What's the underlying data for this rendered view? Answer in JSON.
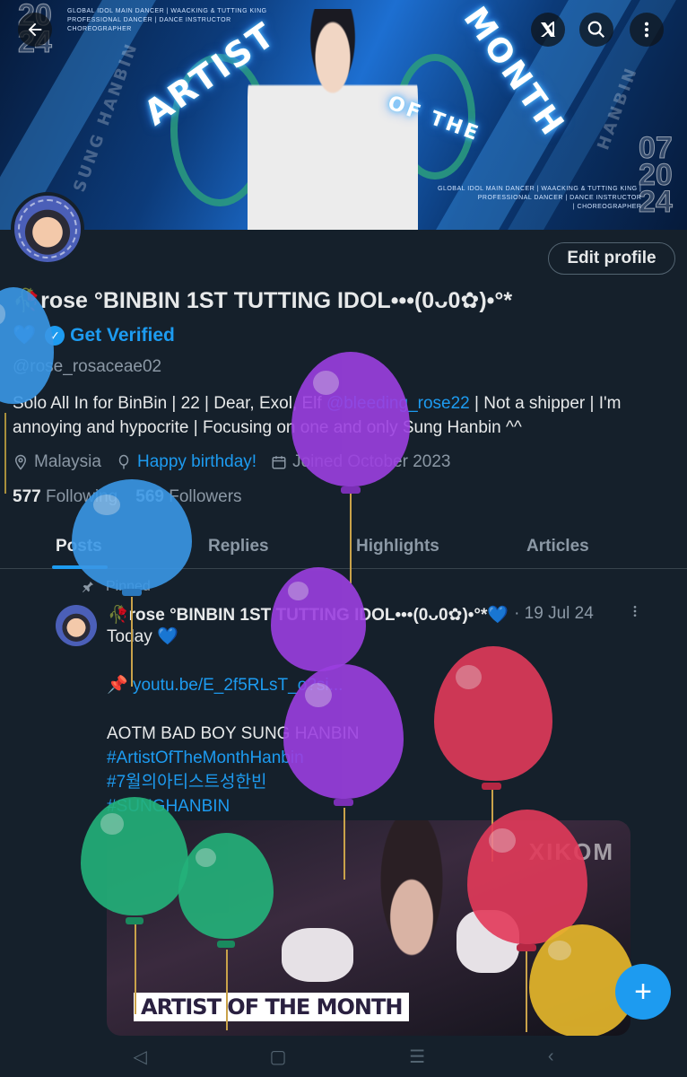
{
  "banner": {
    "headline_left": "ARTIST",
    "headline_of_the": "OF THE",
    "headline_right": "MONTH",
    "year_left": "20\n24",
    "year_right": "07\n20\n24",
    "side_name_left": "SUNG HANBIN",
    "side_name_right": "HANBIN",
    "tagline_left": "GLOBAL IDOL MAIN DANCER | WAACKING & TUTTING KING\nPROFESSIONAL DANCER | DANCE INSTRUCTOR\nCHOREOGRAPHER",
    "tagline_right": "GLOBAL IDOL MAIN DANCER | WAACKING & TUTTING KING |\nPROFESSIONAL DANCER | DANCE INSTRUCTOR\n| CHOREOGRAPHER"
  },
  "top_bar": {
    "back_icon": "arrow-left-icon",
    "grok_icon": "grok-icon",
    "search_icon": "search-icon",
    "more_icon": "more-vertical-icon"
  },
  "profile": {
    "edit_label": "Edit profile",
    "name": "🥀rose °BINBIN 1ST TUTTING IDOL•••(0ᴗ0✿)•°*",
    "name_suffix": "💙",
    "get_verified": "Get Verified",
    "handle": "@rose_rosaceae02",
    "bio_1": "Solo All In for BinBin | 22 | Dear, Exol, Elf ",
    "bio_mention": "@bleeding_rose22",
    "bio_2": " | Not a shipper | I'm annoying and hypocrite | Focusing on one and only Sung Hanbin ^^",
    "location": "Malaysia",
    "birthday": "Happy birthday!",
    "joined": "Joined October 2023",
    "following_count": "577",
    "following_label": "Following",
    "followers_count": "569",
    "followers_label": "Followers"
  },
  "tabs": [
    {
      "label": "Posts",
      "active": true
    },
    {
      "label": "Replies",
      "active": false
    },
    {
      "label": "Highlights",
      "active": false
    },
    {
      "label": "Articles",
      "active": false
    }
  ],
  "post": {
    "pinned_label": "Pinned",
    "author": "🥀rose °BINBIN 1ST TUTTING IDOL•••(0ᴗ0✿)•°*💙",
    "date": "· 19 Jul 24",
    "line_1": "Today 💙",
    "link_prefix": "📌 ",
    "link": "youtu.be/E_2f5RLsT_o?si...",
    "line_3": "AOTM BAD BOY SUNG HANBIN",
    "tag_1": "#ArtistOfTheMonthHanbin",
    "tag_2": "#7월의아티스트성한빈",
    "tag_3": "#SUNGHANBIN",
    "media_caption": "ARTIST OF THE MONTH",
    "media_logo": "XIKOM"
  },
  "fab_label": "+",
  "nav": {
    "back": "◁",
    "home": "▢",
    "recents": "☰",
    "extra": "‹"
  },
  "colors": {
    "background": "#15202b",
    "accent": "#1d9bf0",
    "muted": "#8b98a5",
    "balloon_purple": "#9b3fe0",
    "balloon_blue": "#3a97e6",
    "balloon_red": "#e23a5a",
    "balloon_green": "#23b27a",
    "balloon_yellow": "#e8b92b"
  }
}
